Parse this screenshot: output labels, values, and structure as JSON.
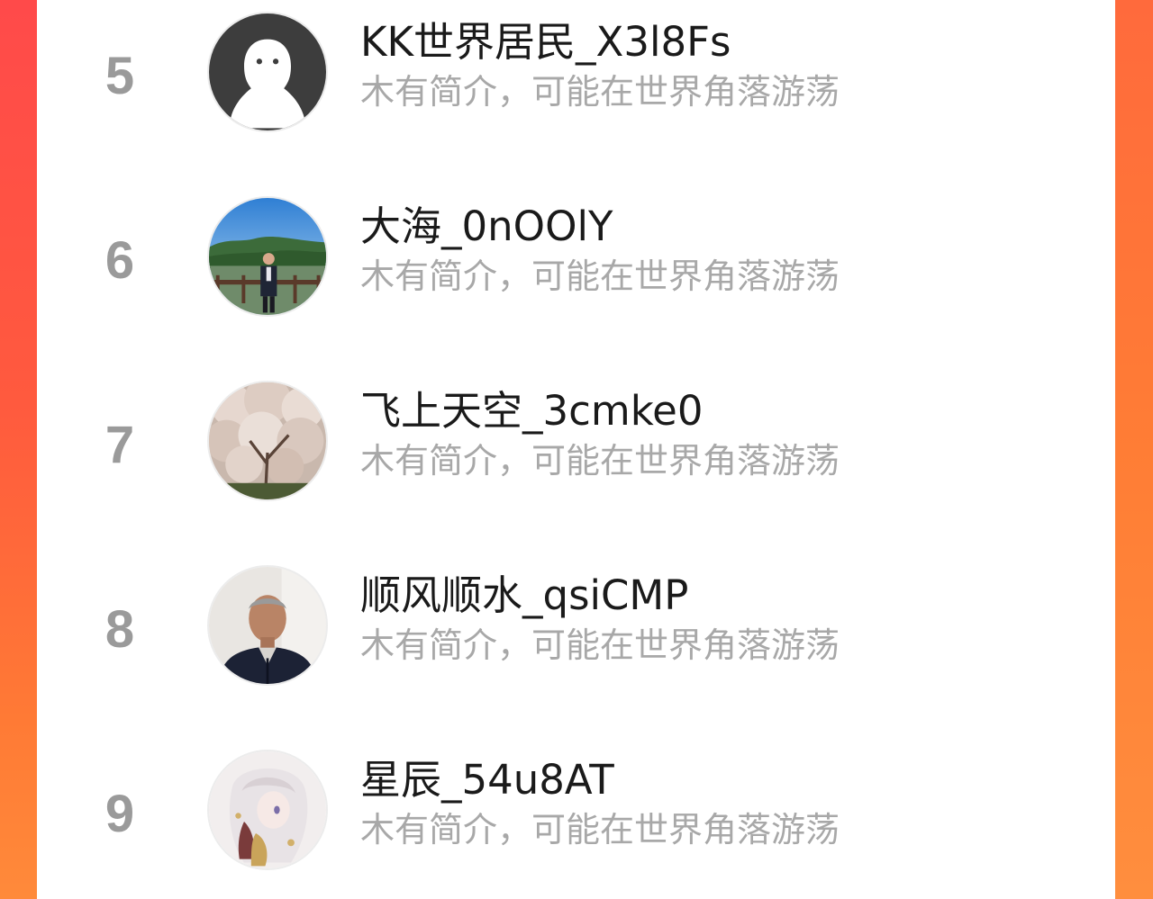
{
  "ranking_list": {
    "items": [
      {
        "rank": "5",
        "name": "KK世界居民_X3l8Fs",
        "bio": "木有简介，可能在世界角落游荡",
        "avatar": "default-ghost-avatar"
      },
      {
        "rank": "6",
        "name": "大海_0nOOlY",
        "bio": "木有简介，可能在世界角落游荡",
        "avatar": "lake-photo-avatar"
      },
      {
        "rank": "7",
        "name": "飞上天空_3cmke0",
        "bio": "木有简介，可能在世界角落游荡",
        "avatar": "blossom-tree-avatar"
      },
      {
        "rank": "8",
        "name": "顺风顺水_qsiCMP",
        "bio": "木有简介，可能在世界角落游荡",
        "avatar": "man-portrait-avatar"
      },
      {
        "rank": "9",
        "name": "星辰_54u8AT",
        "bio": "木有简介，可能在世界角落游荡",
        "avatar": "anime-girl-avatar"
      }
    ]
  },
  "colors": {
    "background_gradient_top": "#ff4a4a",
    "background_gradient_bottom": "#ff8a3a",
    "rank_color": "#9a9a9a",
    "name_color": "#1a1a1a",
    "bio_color": "#a8a8a8"
  }
}
